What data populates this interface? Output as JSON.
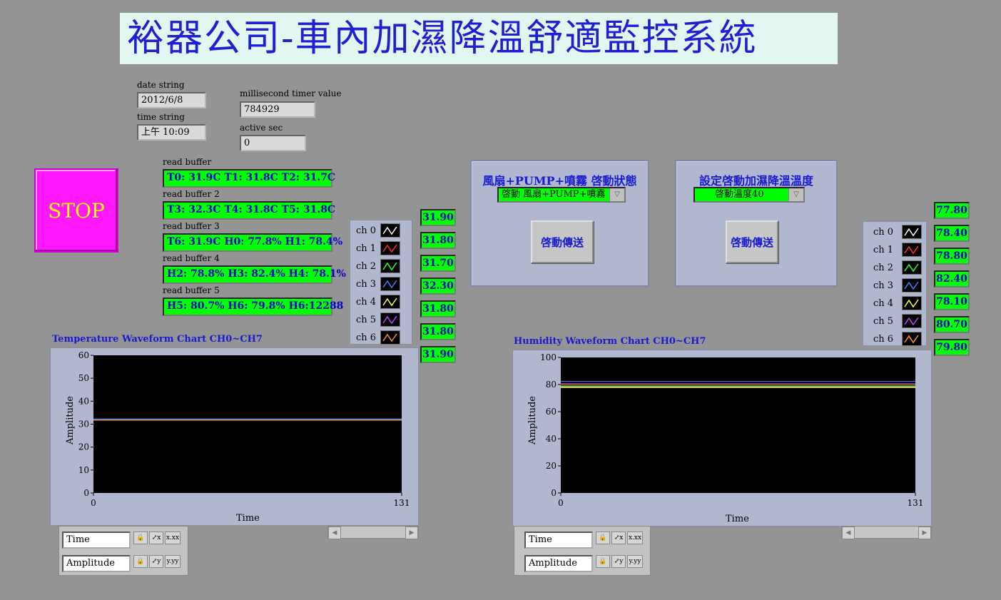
{
  "title": "裕器公司-車內加濕降溫舒適監控系統",
  "date_label": "date string",
  "date_value": "2012/6/8",
  "time_label": "time string",
  "time_value": "上午 10:09",
  "ms_label": "millisecond timer value",
  "ms_value": "784929",
  "active_label": "active sec",
  "active_value": "0",
  "stop_label": "STOP",
  "buffers": [
    {
      "label": "read buffer",
      "value": "T0: 31.9C T1: 31.8C T2: 31.7C"
    },
    {
      "label": "read buffer 2",
      "value": "T3: 32.3C T4: 31.8C T5: 31.8C"
    },
    {
      "label": "read buffer 3",
      "value": "T6: 31.9C H0: 77.8% H1: 78.4%"
    },
    {
      "label": "read buffer 4",
      "value": "H2: 78.8% H3: 82.4% H4: 78.1%"
    },
    {
      "label": "read buffer 5",
      "value": "H5: 80.7% H6: 79.8% H6:12288"
    }
  ],
  "temp_legend": {
    "channels": [
      "ch 0",
      "ch 1",
      "ch 2",
      "ch 3",
      "ch 4",
      "ch 5",
      "ch 6"
    ],
    "colors": [
      "#ffffff",
      "#ff3030",
      "#30ff30",
      "#4080ff",
      "#ffff40",
      "#c040ff",
      "#ff9020"
    ],
    "values": [
      "31.90",
      "31.80",
      "31.70",
      "32.30",
      "31.80",
      "31.80",
      "31.90"
    ]
  },
  "hum_legend": {
    "channels": [
      "ch 0",
      "ch 1",
      "ch 2",
      "ch 3",
      "ch 4",
      "ch 5",
      "ch 6"
    ],
    "colors": [
      "#ffffff",
      "#ff3030",
      "#30ff30",
      "#4080ff",
      "#ffff40",
      "#c040ff",
      "#ff9020"
    ],
    "values": [
      "77.80",
      "78.40",
      "78.80",
      "82.40",
      "78.10",
      "80.70",
      "79.80"
    ]
  },
  "fan_panel": {
    "title": "風扇+PUMP+噴霧 啓動狀態",
    "selected": "啓動 風扇+PUMP+噴霧",
    "button": "啓動傳送"
  },
  "temp_panel": {
    "title": "設定啓動加濕降溫溫度",
    "selected": "啓動溫度40",
    "button": "啓動傳送"
  },
  "palette": {
    "x_name": "Time",
    "y_name": "Amplitude"
  },
  "chart_data": [
    {
      "type": "line",
      "title": "Temperature Waveform Chart CH0~CH7",
      "xlabel": "Time",
      "ylabel": "Amplitude",
      "xlim": [
        0,
        131
      ],
      "ylim": [
        0,
        60
      ],
      "x_ticks": [
        "0",
        "131"
      ],
      "y_ticks": [
        "0",
        "10",
        "20",
        "30",
        "40",
        "50",
        "60"
      ],
      "series": [
        {
          "name": "ch 0",
          "values": [
            31.9,
            31.9
          ]
        },
        {
          "name": "ch 1",
          "values": [
            31.8,
            31.8
          ]
        },
        {
          "name": "ch 2",
          "values": [
            31.7,
            31.7
          ]
        },
        {
          "name": "ch 3",
          "values": [
            32.3,
            32.3
          ]
        },
        {
          "name": "ch 4",
          "values": [
            31.8,
            31.8
          ]
        },
        {
          "name": "ch 5",
          "values": [
            31.8,
            31.8
          ]
        },
        {
          "name": "ch 6",
          "values": [
            31.9,
            31.9
          ]
        }
      ]
    },
    {
      "type": "line",
      "title": "Humidity Waveform Chart CH0~CH7",
      "xlabel": "Time",
      "ylabel": "Amplitude",
      "xlim": [
        0,
        131
      ],
      "ylim": [
        0,
        100
      ],
      "x_ticks": [
        "0",
        "131"
      ],
      "y_ticks": [
        "0",
        "20",
        "40",
        "60",
        "80",
        "100"
      ],
      "series": [
        {
          "name": "ch 0",
          "values": [
            77.8,
            77.8
          ]
        },
        {
          "name": "ch 1",
          "values": [
            78.4,
            78.4
          ]
        },
        {
          "name": "ch 2",
          "values": [
            78.8,
            78.8
          ]
        },
        {
          "name": "ch 3",
          "values": [
            82.4,
            82.4
          ]
        },
        {
          "name": "ch 4",
          "values": [
            78.1,
            78.1
          ]
        },
        {
          "name": "ch 5",
          "values": [
            80.7,
            80.7
          ]
        },
        {
          "name": "ch 6",
          "values": [
            79.8,
            79.8
          ]
        }
      ]
    }
  ]
}
